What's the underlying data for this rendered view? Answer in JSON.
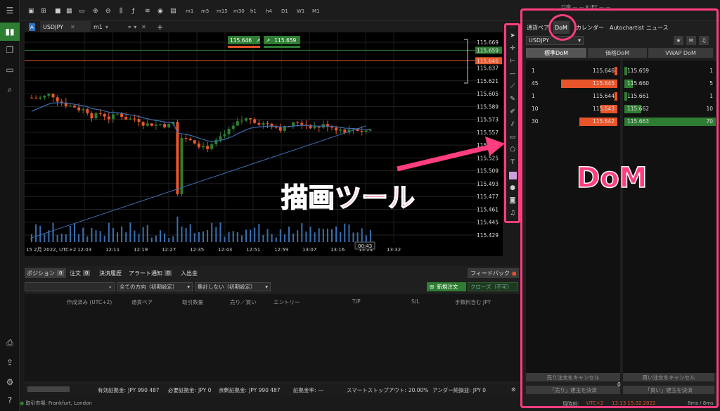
{
  "topbar": {
    "timeframes": [
      "m1",
      "m5",
      "m15",
      "m30",
      "h1",
      "h4",
      "D1",
      "W1",
      "M1"
    ],
    "account": "口座 — — ¥ JPY — —"
  },
  "tabs": {
    "symbol": "USDJPY",
    "timeframe": "m1",
    "add": "+"
  },
  "chart": {
    "sell_price": "115.646",
    "buy_price": "115.659",
    "price_labels": [
      "115.669",
      "115.659",
      "115.646",
      "115.637",
      "115.621",
      "115.605",
      "115.589",
      "115.573",
      "115.557",
      "115.541",
      "115.525",
      "115.509",
      "115.493",
      "115.477",
      "115.461",
      "115.445",
      "115.429"
    ],
    "time_labels": [
      "15 2月 2022, UTC+2",
      "12:03",
      "12:11",
      "12:19",
      "12:27",
      "12:35",
      "12:43",
      "12:51",
      "12:59",
      "13:07",
      "13:16",
      "13:24",
      "13:32"
    ],
    "countdown": "00:43",
    "colors": {
      "up": "#2e7d32",
      "down": "#e8552a",
      "ma": "#3a6fb0"
    }
  },
  "annotations": {
    "tools_label": "描画ツール",
    "dom_label": "DoM"
  },
  "rpanel": {
    "tabs": [
      "通貨ペア",
      "DoM",
      "カレンダー",
      "Autochartist",
      "ニュース"
    ],
    "pair": "USDJPY",
    "subtabs": [
      "標準DoM",
      "価格DoM",
      "VWAP DoM"
    ],
    "sell_rows": [
      {
        "vol": "1",
        "price": "115.646"
      },
      {
        "vol": "45",
        "price": "115.645"
      },
      {
        "vol": "1",
        "price": "115.644"
      },
      {
        "vol": "10",
        "price": "115.643"
      },
      {
        "vol": "30",
        "price": "115.642"
      }
    ],
    "buy_rows": [
      {
        "vol": "1",
        "price": "115.659"
      },
      {
        "vol": "5",
        "price": "115.660"
      },
      {
        "vol": "1",
        "price": "115.661"
      },
      {
        "vol": "10",
        "price": "115.662"
      },
      {
        "vol": "70",
        "price": "115.663"
      }
    ],
    "cancel_sell": "売り注文をキャンセル",
    "cancel_buy": "買い注文をキャンセル",
    "close_sell": "「売り」建玉を決済",
    "close_buy": "「買い」建玉を決済",
    "center_val": "0",
    "status": {
      "time_label": "現時刻:",
      "tz": "UTC+2",
      "time": "13:13 15.02.2022",
      "ping": "8ms / 8ms"
    }
  },
  "bottom": {
    "tabs": [
      {
        "label": "ポジション",
        "count": "0"
      },
      {
        "label": "注文",
        "count": "0"
      },
      {
        "label": "決済履歴"
      },
      {
        "label": "アラート通知",
        "count": "0"
      },
      {
        "label": "入出金"
      }
    ],
    "feedback": "フィードバック",
    "filter1": "全ての方向（初期設定）",
    "filter2": "集計しない（初期設定）",
    "new_order": "新規注文",
    "close_unavail": "クローズ（不可）",
    "headers": [
      "作成済み (UTC+2)",
      "通貨ペア",
      "取引数量",
      "売り／買い",
      "エントリー",
      "T/P",
      "S/L",
      "手数料含む JPY"
    ],
    "status": [
      {
        "k": "有効証拠金:",
        "v": "JPY 990 487"
      },
      {
        "k": "必要証拠金:",
        "v": "JPY 0"
      },
      {
        "k": "余剰証拠金:",
        "v": "JPY 990 487"
      },
      {
        "k": "証拠金率:",
        "v": "—"
      },
      {
        "k": "スマートストップアウト:",
        "v": "20.00%"
      },
      {
        "k": "アンダー純損益:",
        "v": "JPY 0"
      }
    ],
    "market": "取引市場: Frankfurt, London"
  }
}
